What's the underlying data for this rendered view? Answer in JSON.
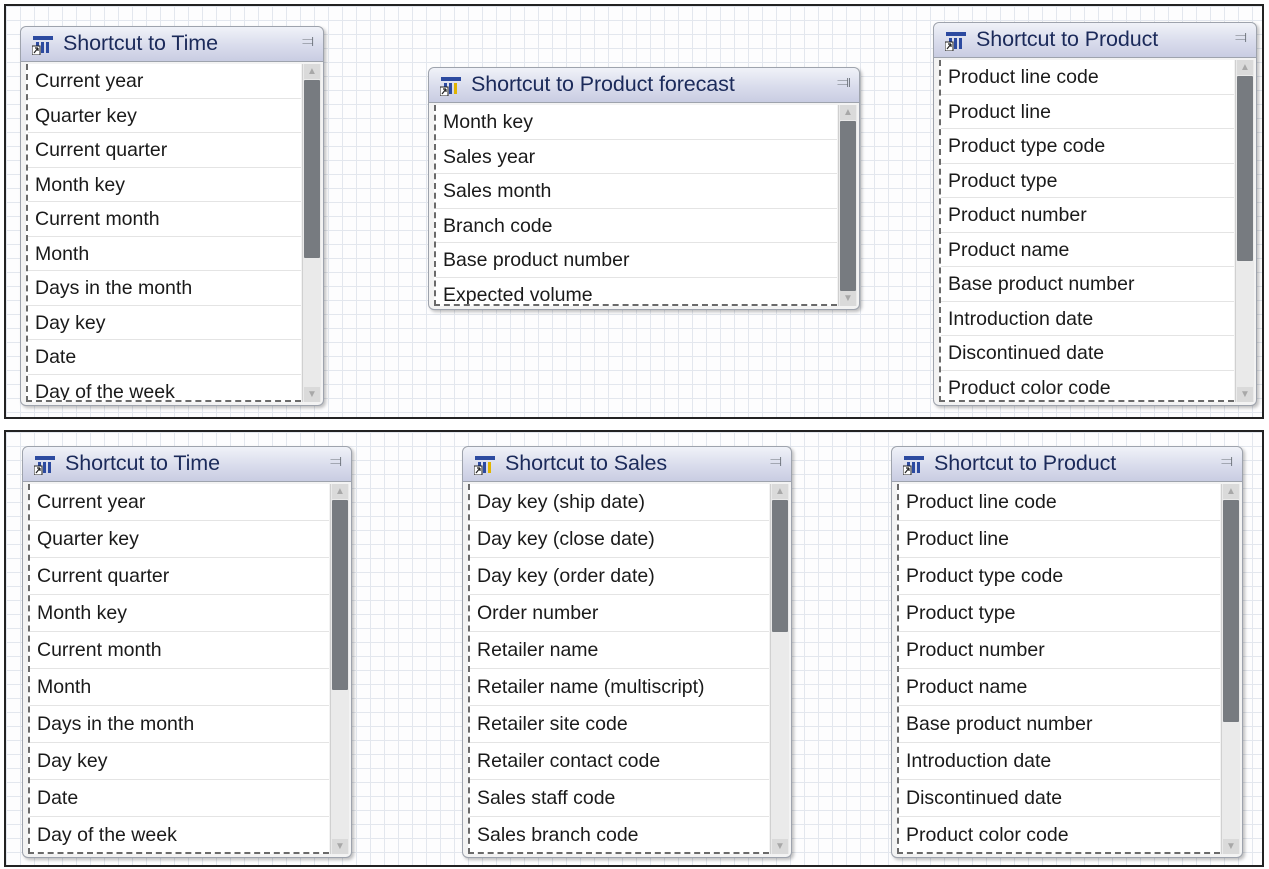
{
  "top_panel": {
    "time": {
      "title": "Shortcut to Time",
      "items": [
        "Current year",
        "Quarter key",
        "Current quarter",
        "Month key",
        "Current month",
        "Month",
        "Days in the month",
        "Day key",
        "Date",
        "Day of the week"
      ]
    },
    "forecast": {
      "title": "Shortcut to Product forecast",
      "items": [
        "Month key",
        "Sales year",
        "Sales month",
        "Branch code",
        "Base product number",
        "Expected volume"
      ]
    },
    "product": {
      "title": "Shortcut to Product",
      "items": [
        "Product line code",
        "Product line",
        "Product type code",
        "Product type",
        "Product number",
        "Product name",
        "Base product number",
        "Introduction date",
        "Discontinued date",
        "Product color code"
      ]
    }
  },
  "bottom_panel": {
    "time": {
      "title": "Shortcut to Time",
      "items": [
        "Current year",
        "Quarter key",
        "Current quarter",
        "Month key",
        "Current month",
        "Month",
        "Days in the month",
        "Day key",
        "Date",
        "Day of the week"
      ]
    },
    "sales": {
      "title": "Shortcut to Sales",
      "items": [
        "Day key (ship date)",
        "Day key (close date)",
        "Day key (order date)",
        "Order number",
        "Retailer name",
        "Retailer name (multiscript)",
        "Retailer site code",
        "Retailer contact code",
        "Sales staff code",
        "Sales branch code"
      ]
    },
    "product": {
      "title": "Shortcut to Product",
      "items": [
        "Product line code",
        "Product line",
        "Product type code",
        "Product type",
        "Product number",
        "Product name",
        "Base product number",
        "Introduction date",
        "Discontinued date",
        "Product color code"
      ]
    }
  },
  "icons": {
    "subject": "query-subject-shortcut-icon",
    "collapse": "chevron-double-down-icon",
    "expand": "chevron-double-up-icon"
  },
  "colors": {
    "accent_header": "#1b2a5a",
    "icon_blue": "#2c4aa0",
    "icon_yellow": "#e0b400"
  }
}
